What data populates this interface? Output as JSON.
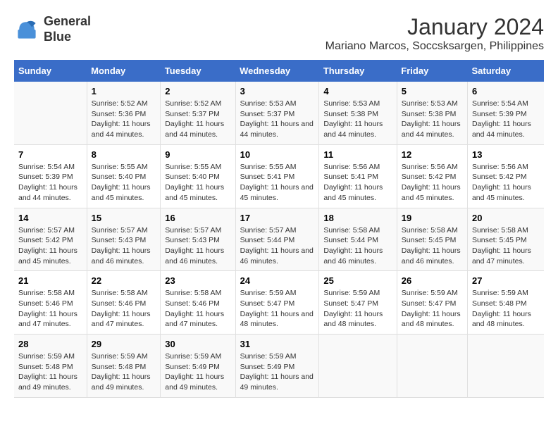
{
  "logo": {
    "line1": "General",
    "line2": "Blue"
  },
  "title": "January 2024",
  "subtitle": "Mariano Marcos, Soccsksargen, Philippines",
  "headers": [
    "Sunday",
    "Monday",
    "Tuesday",
    "Wednesday",
    "Thursday",
    "Friday",
    "Saturday"
  ],
  "weeks": [
    [
      {
        "day": "",
        "sunrise": "",
        "sunset": "",
        "daylight": ""
      },
      {
        "day": "1",
        "sunrise": "Sunrise: 5:52 AM",
        "sunset": "Sunset: 5:36 PM",
        "daylight": "Daylight: 11 hours and 44 minutes."
      },
      {
        "day": "2",
        "sunrise": "Sunrise: 5:52 AM",
        "sunset": "Sunset: 5:37 PM",
        "daylight": "Daylight: 11 hours and 44 minutes."
      },
      {
        "day": "3",
        "sunrise": "Sunrise: 5:53 AM",
        "sunset": "Sunset: 5:37 PM",
        "daylight": "Daylight: 11 hours and 44 minutes."
      },
      {
        "day": "4",
        "sunrise": "Sunrise: 5:53 AM",
        "sunset": "Sunset: 5:38 PM",
        "daylight": "Daylight: 11 hours and 44 minutes."
      },
      {
        "day": "5",
        "sunrise": "Sunrise: 5:53 AM",
        "sunset": "Sunset: 5:38 PM",
        "daylight": "Daylight: 11 hours and 44 minutes."
      },
      {
        "day": "6",
        "sunrise": "Sunrise: 5:54 AM",
        "sunset": "Sunset: 5:39 PM",
        "daylight": "Daylight: 11 hours and 44 minutes."
      }
    ],
    [
      {
        "day": "7",
        "sunrise": "Sunrise: 5:54 AM",
        "sunset": "Sunset: 5:39 PM",
        "daylight": "Daylight: 11 hours and 44 minutes."
      },
      {
        "day": "8",
        "sunrise": "Sunrise: 5:55 AM",
        "sunset": "Sunset: 5:40 PM",
        "daylight": "Daylight: 11 hours and 45 minutes."
      },
      {
        "day": "9",
        "sunrise": "Sunrise: 5:55 AM",
        "sunset": "Sunset: 5:40 PM",
        "daylight": "Daylight: 11 hours and 45 minutes."
      },
      {
        "day": "10",
        "sunrise": "Sunrise: 5:55 AM",
        "sunset": "Sunset: 5:41 PM",
        "daylight": "Daylight: 11 hours and 45 minutes."
      },
      {
        "day": "11",
        "sunrise": "Sunrise: 5:56 AM",
        "sunset": "Sunset: 5:41 PM",
        "daylight": "Daylight: 11 hours and 45 minutes."
      },
      {
        "day": "12",
        "sunrise": "Sunrise: 5:56 AM",
        "sunset": "Sunset: 5:42 PM",
        "daylight": "Daylight: 11 hours and 45 minutes."
      },
      {
        "day": "13",
        "sunrise": "Sunrise: 5:56 AM",
        "sunset": "Sunset: 5:42 PM",
        "daylight": "Daylight: 11 hours and 45 minutes."
      }
    ],
    [
      {
        "day": "14",
        "sunrise": "Sunrise: 5:57 AM",
        "sunset": "Sunset: 5:42 PM",
        "daylight": "Daylight: 11 hours and 45 minutes."
      },
      {
        "day": "15",
        "sunrise": "Sunrise: 5:57 AM",
        "sunset": "Sunset: 5:43 PM",
        "daylight": "Daylight: 11 hours and 46 minutes."
      },
      {
        "day": "16",
        "sunrise": "Sunrise: 5:57 AM",
        "sunset": "Sunset: 5:43 PM",
        "daylight": "Daylight: 11 hours and 46 minutes."
      },
      {
        "day": "17",
        "sunrise": "Sunrise: 5:57 AM",
        "sunset": "Sunset: 5:44 PM",
        "daylight": "Daylight: 11 hours and 46 minutes."
      },
      {
        "day": "18",
        "sunrise": "Sunrise: 5:58 AM",
        "sunset": "Sunset: 5:44 PM",
        "daylight": "Daylight: 11 hours and 46 minutes."
      },
      {
        "day": "19",
        "sunrise": "Sunrise: 5:58 AM",
        "sunset": "Sunset: 5:45 PM",
        "daylight": "Daylight: 11 hours and 46 minutes."
      },
      {
        "day": "20",
        "sunrise": "Sunrise: 5:58 AM",
        "sunset": "Sunset: 5:45 PM",
        "daylight": "Daylight: 11 hours and 47 minutes."
      }
    ],
    [
      {
        "day": "21",
        "sunrise": "Sunrise: 5:58 AM",
        "sunset": "Sunset: 5:46 PM",
        "daylight": "Daylight: 11 hours and 47 minutes."
      },
      {
        "day": "22",
        "sunrise": "Sunrise: 5:58 AM",
        "sunset": "Sunset: 5:46 PM",
        "daylight": "Daylight: 11 hours and 47 minutes."
      },
      {
        "day": "23",
        "sunrise": "Sunrise: 5:58 AM",
        "sunset": "Sunset: 5:46 PM",
        "daylight": "Daylight: 11 hours and 47 minutes."
      },
      {
        "day": "24",
        "sunrise": "Sunrise: 5:59 AM",
        "sunset": "Sunset: 5:47 PM",
        "daylight": "Daylight: 11 hours and 48 minutes."
      },
      {
        "day": "25",
        "sunrise": "Sunrise: 5:59 AM",
        "sunset": "Sunset: 5:47 PM",
        "daylight": "Daylight: 11 hours and 48 minutes."
      },
      {
        "day": "26",
        "sunrise": "Sunrise: 5:59 AM",
        "sunset": "Sunset: 5:47 PM",
        "daylight": "Daylight: 11 hours and 48 minutes."
      },
      {
        "day": "27",
        "sunrise": "Sunrise: 5:59 AM",
        "sunset": "Sunset: 5:48 PM",
        "daylight": "Daylight: 11 hours and 48 minutes."
      }
    ],
    [
      {
        "day": "28",
        "sunrise": "Sunrise: 5:59 AM",
        "sunset": "Sunset: 5:48 PM",
        "daylight": "Daylight: 11 hours and 49 minutes."
      },
      {
        "day": "29",
        "sunrise": "Sunrise: 5:59 AM",
        "sunset": "Sunset: 5:48 PM",
        "daylight": "Daylight: 11 hours and 49 minutes."
      },
      {
        "day": "30",
        "sunrise": "Sunrise: 5:59 AM",
        "sunset": "Sunset: 5:49 PM",
        "daylight": "Daylight: 11 hours and 49 minutes."
      },
      {
        "day": "31",
        "sunrise": "Sunrise: 5:59 AM",
        "sunset": "Sunset: 5:49 PM",
        "daylight": "Daylight: 11 hours and 49 minutes."
      },
      {
        "day": "",
        "sunrise": "",
        "sunset": "",
        "daylight": ""
      },
      {
        "day": "",
        "sunrise": "",
        "sunset": "",
        "daylight": ""
      },
      {
        "day": "",
        "sunrise": "",
        "sunset": "",
        "daylight": ""
      }
    ]
  ]
}
